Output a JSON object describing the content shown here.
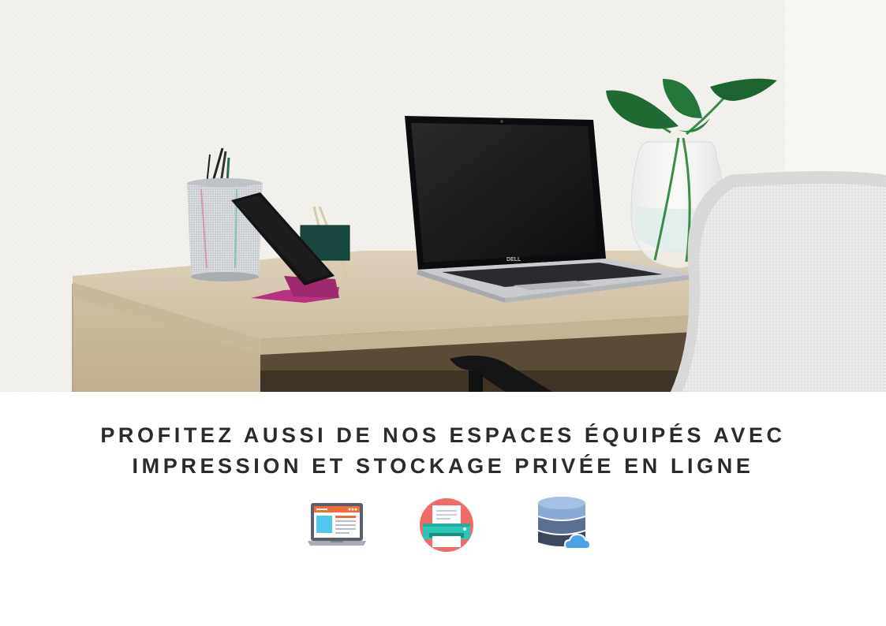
{
  "headline": {
    "line1": "PROFITEZ AUSSI DE NOS ESPACES ÉQUIPÉS AVEC",
    "line2": "IMPRESSION ET STOCKAGE PRIVÉE EN LIGNE"
  },
  "hero": {
    "laptop_brand": "DELL"
  },
  "icons": [
    {
      "name": "laptop-icon"
    },
    {
      "name": "printer-icon"
    },
    {
      "name": "cloud-database-icon"
    }
  ],
  "colors": {
    "text": "#2b2b2b",
    "wall": "#f3f2ee",
    "desk": "#d9cbb3",
    "printer_circle": "#f26b6b",
    "printer_body": "#2bc6b4",
    "laptop_screen": "#4fc7ee",
    "laptop_header": "#f26b3a",
    "db_top": "#8aa9d8",
    "db_mid": "#5b6f93",
    "db_bottom": "#3c4660",
    "cloud": "#4aa3e6"
  }
}
